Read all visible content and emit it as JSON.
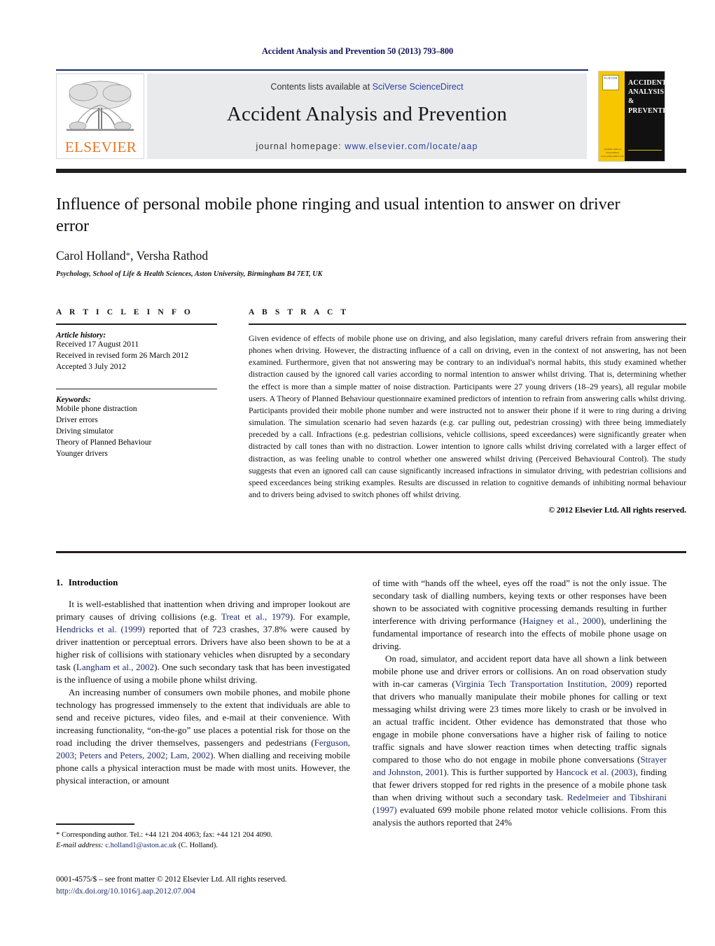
{
  "running_head": "Accident Analysis and Prevention 50 (2013) 793–800",
  "journal_header": {
    "contents_prefix": "Contents lists available at ",
    "contents_link": "SciVerse ScienceDirect",
    "journal_title": "Accident Analysis and Prevention",
    "homepage_prefix": "journal homepage: ",
    "homepage_url": "www.elsevier.com/locate/aap",
    "publisher_wordmark": "ELSEVIER",
    "cover_title": "ACCIDENT ANALYSIS & PREVENTION",
    "cover_footer": "available online at ScienceDirect www.sciencedirect.com",
    "accent_blue": "#2b3f9e",
    "accent_orange": "#e87722",
    "cover_yellow": "#f7c600"
  },
  "article": {
    "title": "Influence of personal mobile phone ringing and usual intention to answer on driver error",
    "authors": "Carol Holland",
    "authors_rest": ", Versha Rathod",
    "corresponding_marker": "*",
    "affiliation": "Psychology, School of Life & Health Sciences, Aston University, Birmingham B4 7ET, UK"
  },
  "article_info": {
    "section_label": "A R T I C L E   I N F O",
    "history_heading": "Article history:",
    "history": [
      "Received 17 August 2011",
      "Received in revised form 26 March 2012",
      "Accepted 3 July 2012"
    ],
    "keywords_heading": "Keywords:",
    "keywords": [
      "Mobile phone distraction",
      "Driver errors",
      "Driving simulator",
      "Theory of Planned Behaviour",
      "Younger drivers"
    ]
  },
  "abstract": {
    "section_label": "A B S T R A C T",
    "text": "Given evidence of effects of mobile phone use on driving, and also legislation, many careful drivers refrain from answering their phones when driving. However, the distracting influence of a call on driving, even in the context of not answering, has not been examined. Furthermore, given that not answering may be contrary to an individual's normal habits, this study examined whether distraction caused by the ignored call varies according to normal intention to answer whilst driving. That is, determining whether the effect is more than a simple matter of noise distraction. Participants were 27 young drivers (18–29 years), all regular mobile users. A Theory of Planned Behaviour questionnaire examined predictors of intention to refrain from answering calls whilst driving. Participants provided their mobile phone number and were instructed not to answer their phone if it were to ring during a driving simulation. The simulation scenario had seven hazards (e.g. car pulling out, pedestrian crossing) with three being immediately preceded by a call. Infractions (e.g. pedestrian collisions, vehicle collisions, speed exceedances) were significantly greater when distracted by call tones than with no distraction. Lower intention to ignore calls whilst driving correlated with a larger effect of distraction, as was feeling unable to control whether one answered whilst driving (Perceived Behavioural Control). The study suggests that even an ignored call can cause significantly increased infractions in simulator driving, with pedestrian collisions and speed exceedances being striking examples. Results are discussed in relation to cognitive demands of inhibiting normal behaviour and to drivers being advised to switch phones off whilst driving.",
    "copyright": "© 2012 Elsevier Ltd. All rights reserved."
  },
  "introduction": {
    "number": "1.",
    "heading": "Introduction",
    "left_para_1": {
      "a": "It is well-established that inattention when driving and improper lookout are primary causes of driving collisions (e.g. ",
      "ref1": "Treat et al., 1979",
      "b": "). For example, ",
      "ref2": "Hendricks et al. (1999)",
      "c": " reported that of 723 crashes, 37.8% were caused by driver inattention or perceptual errors. Drivers have also been shown to be at a higher risk of collisions with stationary vehicles when disrupted by a secondary task (",
      "ref3": "Langham et al., 2002",
      "d": "). One such secondary task that has been investigated is the influence of using a mobile phone whilst driving."
    },
    "left_para_2": {
      "a": "An increasing number of consumers own mobile phones, and mobile phone technology has progressed immensely to the extent that individuals are able to send and receive pictures, video files, and e-mail at their convenience. With increasing functionality, “on-the-go” use places a potential risk for those on the road including the driver themselves, passengers and pedestrians (",
      "ref1": "Ferguson, 2003; Peters and Peters, 2002; Lam, 2002",
      "b": "). When dialling and receiving mobile phone calls a physical interaction must be made with most units. However, the physical interaction, or amount"
    },
    "right_para_1": {
      "a": "of time with “hands off the wheel, eyes off the road” is not the only issue. The secondary task of dialling numbers, keying texts or other responses have been shown to be associated with cognitive processing demands resulting in further interference with driving performance (",
      "ref1": "Haigney et al., 2000",
      "b": "), underlining the fundamental importance of research into the effects of mobile phone usage on driving."
    },
    "right_para_2": {
      "a": "On road, simulator, and accident report data have all shown a link between mobile phone use and driver errors or collisions. An on road observation study with in-car cameras (",
      "ref1": "Virginia Tech Transportation Institution, 2009",
      "b": ") reported that drivers who manually manipulate their mobile phones for calling or text messaging whilst driving were 23 times more likely to crash or be involved in an actual traffic incident. Other evidence has demonstrated that those who engage in mobile phone conversations have a higher risk of failing to notice traffic signals and have slower reaction times when detecting traffic signals compared to those who do not engage in mobile phone conversations (",
      "ref2": "Strayer and Johnston, 2001",
      "c": "). This is further supported by ",
      "ref3": "Hancock et al. (2003)",
      "d": ", finding that fewer drivers stopped for red rights in the presence of a mobile phone task than when driving without such a secondary task. ",
      "ref4": "Redelmeier and Tibshirani (1997)",
      "e": " evaluated 699 mobile phone related motor vehicle collisions. From this analysis the authors reported that 24%"
    }
  },
  "footnote": {
    "marker": "*",
    "text_a": " Corresponding author. Tel.: +44 121 204 4063; fax: +44 121 204 4090.",
    "email_label": "E-mail address:",
    "email": "c.holland1@aston.ac.uk",
    "email_owner": " (C. Holland)."
  },
  "bottom_matter": {
    "issn_line": "0001-4575/$ – see front matter © 2012 Elsevier Ltd. All rights reserved.",
    "doi": "http://dx.doi.org/10.1016/j.aap.2012.07.004"
  }
}
